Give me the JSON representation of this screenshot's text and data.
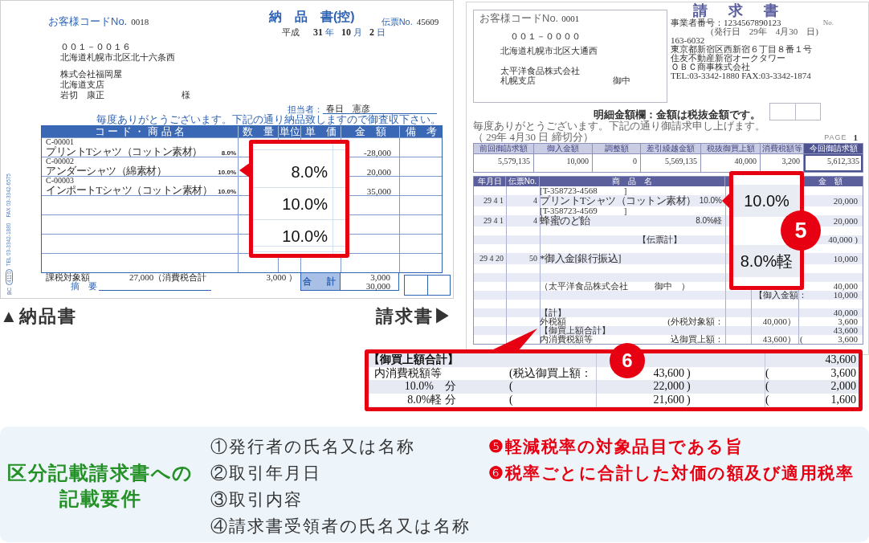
{
  "delivery_slip": {
    "customer_code_label": "お客様コードNo.",
    "customer_code": "0018",
    "title": "納　品　書(控)",
    "slip_no_label": "伝票No.",
    "slip_no": "45609",
    "date": {
      "era": "平成",
      "year": "31",
      "month": "10",
      "day": "2",
      "units": [
        "年",
        "月",
        "日"
      ]
    },
    "postal_code": "００１－００１６",
    "address": "北海道札幌市北区北十六条西",
    "recipient_lines": [
      "株式会社福岡屋",
      "北海道支店",
      "岩切　康正"
    ],
    "honorific": "様",
    "staff_label": "担当者：",
    "staff": "春日　憲彦",
    "greeting": "毎度ありがとうございます。下記の通り納品致しますので御査収下さい。",
    "columns": [
      "コ ー ド ・ 商 品 名",
      "数　量",
      "単位",
      "単　価",
      "金　額",
      "備　考"
    ],
    "rows": [
      {
        "code": "C-00001",
        "name": "プリントTシャツ（コットン素材）",
        "rate": "8.0%",
        "amount": "-28,000"
      },
      {
        "code": "C-00002",
        "name": "アンダーシャツ（綿素材）",
        "rate": "10.0%",
        "amount": "20,000"
      },
      {
        "code": "C-00003",
        "name": "インポートTシャツ（コットン素材）",
        "rate": "10.0%",
        "amount": "35,000"
      }
    ],
    "footer": {
      "taxable_label": "課税対象額",
      "taxable_amount": "27,000",
      "tax_label": "（消費税合計",
      "tax_amount": "3,000 ）",
      "total_label": "合　計",
      "total_tax": "3,000",
      "total_amount": "30,000",
      "remarks_label": "摘　要"
    },
    "side_print": {
      "prefix": "BC",
      "code": "4110",
      "contact": "TEL 03-3342-1880　FAX 03-3342-6575"
    }
  },
  "delivery_callout": {
    "rates": [
      "8.0%",
      "10.0%",
      "10.0%"
    ]
  },
  "captions": {
    "left": "▲納品書",
    "right": "請求書▶"
  },
  "invoice": {
    "customer_code_label": "お客様コードNo.",
    "customer_code": "0001",
    "postal_code": "００１－００００",
    "address": "北海道札幌市北区大通西",
    "recipient_lines": [
      "太平洋食品株式会社",
      "札幌支店"
    ],
    "honorific": "御中",
    "title": "請　求　書",
    "registration_label": "事業者番号：",
    "registration_no": "1234567890123",
    "no_label": "No.",
    "issue_date": "(発行日　29年　4月30　日)",
    "issuer_lines": [
      "163-6032",
      "東京都新宿区西新宿６丁目８番１号",
      "住友不動産新宿オークタワー",
      "ＯＢＣ商事株式会社",
      "TEL:03-3342-1880 FAX:03-3342-1874"
    ],
    "amount_note": "明細金額欄：金額は税抜金額です。",
    "greeting": "毎度ありがとうございます。下記の通り御請求申し上げます。（ 29年 4月30 日 締切分）",
    "page_label": "PAGE",
    "page": "1",
    "summary_columns": [
      "前回御請求額",
      "御入金額",
      "調整額",
      "差引繰越金額",
      "税抜御買上額",
      "消費税額等",
      "今回御請求額"
    ],
    "summary_values": [
      "5,579,135",
      "10,000",
      "0",
      "5,569,135",
      "40,000",
      "3,200",
      "5,612,335"
    ],
    "detail_columns": [
      "年月日",
      "伝票No.",
      "商　品　名",
      "金　額"
    ],
    "detail_rows": [
      {
        "kind": "entry",
        "name": "[T-358723-4568　　　]"
      },
      {
        "kind": "entry",
        "date": "29 4 1",
        "slip": "4",
        "name": "プリントTシャツ（コットン素材）",
        "rate": "10.0%",
        "amount": "20,000"
      },
      {
        "kind": "entry",
        "name": "[T-358723-4569　　　]"
      },
      {
        "kind": "entry",
        "date": "29 4 1",
        "slip": "4",
        "name": "蜂蜜のど飴",
        "rate": "8.0%軽",
        "amount": "20,000"
      },
      {
        "kind": "blank"
      },
      {
        "kind": "entry",
        "subtotal_label": "【伝票計】",
        "amount": "40,000 )"
      },
      {
        "kind": "blank"
      },
      {
        "kind": "entry",
        "date": "29 4 20",
        "slip": "50",
        "name": "*御入金[銀行振込]",
        "amount": "10,000"
      },
      {
        "kind": "blank"
      },
      {
        "kind": "blank"
      },
      {
        "kind": "entry",
        "name": "（太平洋食品株式会社　　　御中　）",
        "amount": "40,000"
      },
      {
        "kind": "entry",
        "payment_label": "【御入金額：",
        "amount": "10,000"
      },
      {
        "kind": "blank"
      },
      {
        "kind": "entry",
        "name": "【計】",
        "amount": "40,000"
      },
      {
        "kind": "entry",
        "name": "外税額",
        "note": "(外税対象額：",
        "base": "40,000）",
        "amount": "3,600"
      },
      {
        "kind": "entry",
        "name": "【御買上額合計】",
        "amount": "43,600"
      },
      {
        "kind": "entry",
        "name": "内消費税額等",
        "note": "込御買上額：",
        "base": "43,600）",
        "open": "(",
        "amount": "3,600"
      }
    ]
  },
  "invoice_callout": {
    "badge": "5",
    "rates": [
      "10.0%",
      "8.0%軽"
    ]
  },
  "tax_summary_callout": {
    "badge": "6",
    "rows": [
      {
        "kind": "total",
        "label": "【御買上額合計】",
        "amount": "43,600"
      },
      {
        "kind": "tax",
        "label": "内消費税額等",
        "note": "(税込御買上額：",
        "base": "43,600",
        "close": ")",
        "open": "(",
        "amount": "3,600"
      },
      {
        "kind": "rate",
        "label": "10.0%　分",
        "note": "(",
        "base": "22,000",
        "close": ")",
        "open": "(",
        "amount": "2,000"
      },
      {
        "kind": "rate",
        "label": "8.0%軽 分",
        "note": "(",
        "base": "21,600",
        "close": ")",
        "open": "(",
        "amount": "1,600"
      }
    ]
  },
  "requirements": {
    "title": "区分記載請求書への記載要件",
    "items": [
      "①発行者の氏名又は名称",
      "②取引年月日",
      "③取引内容",
      "④請求書受領者の氏名又は名称"
    ],
    "highlighted": [
      "❺軽減税率の対象品目である旨",
      "❻税率ごとに合計した対価の額及び適用税率"
    ]
  }
}
